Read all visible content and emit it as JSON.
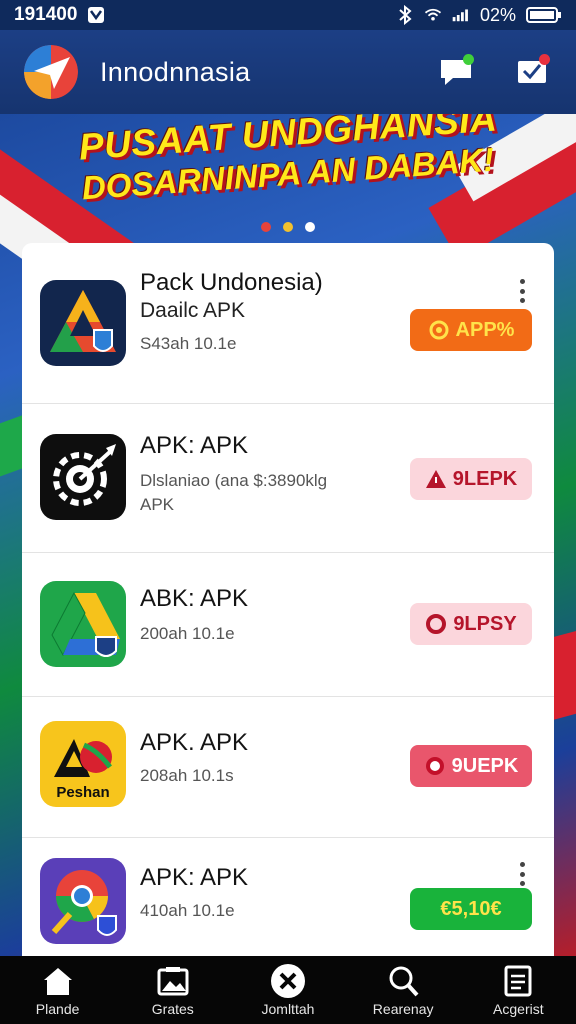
{
  "status_bar": {
    "time": "191400",
    "battery_text": "02%"
  },
  "header": {
    "title": "Innodnnasia"
  },
  "banner": {
    "line1": "PUSAAT UNDGHANSIA",
    "line2": "DOSARNINPA AN DABAK!",
    "dot_colors": [
      "#e8433a",
      "#f2c12e",
      "#ffffff"
    ]
  },
  "apps": [
    {
      "name": "Pack Undonesia)",
      "line2": "Daailc APK",
      "meta": [
        "S43ah 10.1e"
      ],
      "button_label": "APP%",
      "button_bg": "#f26b16",
      "button_fg": "#ffe34a",
      "icon": "delta-shield-icon"
    },
    {
      "name": "APK: APK",
      "meta": [
        "Dlslaniao (ana $:3890klg",
        "APK"
      ],
      "button_label": "9LEPK",
      "button_bg": "#fbd6dc",
      "button_fg": "#b5152b",
      "icon": "target-gear-icon"
    },
    {
      "name": "ABK: APK",
      "meta": [
        "200ah 10.1e"
      ],
      "button_label": "9LPSY",
      "button_bg": "#fbd6dc",
      "button_fg": "#b5152b",
      "icon": "drive-triangle-icon"
    },
    {
      "name": "APK. APK",
      "meta": [
        "208ah 10.1s"
      ],
      "button_label": "9UEPK",
      "button_bg": "#e9566c",
      "button_fg": "#ffffff",
      "icon": "peak-logo-icon",
      "icon_caption": "Peshan"
    },
    {
      "name": "APK: APK",
      "meta": [
        "410ah 10.1e"
      ],
      "button_label": "€5,10€",
      "button_bg": "#19b33b",
      "button_fg": "#ffe34a",
      "icon": "chrome-pin-icon"
    }
  ],
  "bottom_nav": [
    {
      "label": "Plande",
      "icon": "home-icon"
    },
    {
      "label": "Grates",
      "icon": "gallery-icon"
    },
    {
      "label": "Jomlttah",
      "icon": "close-circle-icon"
    },
    {
      "label": "Rearenay",
      "icon": "search-icon"
    },
    {
      "label": "Acgerist",
      "icon": "document-icon"
    }
  ],
  "colors": {
    "header": "#1c3f85",
    "bottom_nav": "#060606"
  }
}
